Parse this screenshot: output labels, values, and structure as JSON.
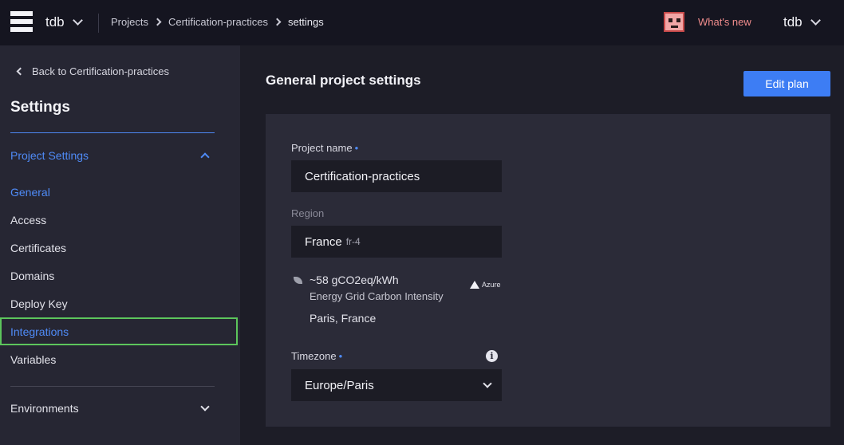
{
  "topbar": {
    "org_name": "tdb",
    "breadcrumb": [
      "Projects",
      "Certification-practices",
      "settings"
    ],
    "whats_new": "What's new",
    "user_name": "tdb"
  },
  "sidebar": {
    "back_label": "Back to Certification-practices",
    "title": "Settings",
    "section_label": "Project Settings",
    "items": [
      {
        "label": "General"
      },
      {
        "label": "Access"
      },
      {
        "label": "Certificates"
      },
      {
        "label": "Domains"
      },
      {
        "label": "Deploy Key"
      },
      {
        "label": "Integrations"
      },
      {
        "label": "Variables"
      }
    ],
    "environments_label": "Environments"
  },
  "main": {
    "title": "General project settings",
    "edit_plan_label": "Edit plan",
    "project_name_label": "Project name",
    "required_marker": "•",
    "project_name_value": "Certification-practices",
    "region_label": "Region",
    "region_name": "France",
    "region_code": "fr-4",
    "carbon_value": "~58 gCO2eq/kWh",
    "carbon_caption": "Energy Grid Carbon Intensity",
    "region_city": "Paris, France",
    "provider": "Azure",
    "timezone_label": "Timezone",
    "info_glyph": "i",
    "timezone_value": "Europe/Paris"
  },
  "colors": {
    "accent": "#4f8bf7",
    "button": "#3d7df4",
    "highlight_border": "#5cc55c",
    "whats_new": "#f08c8c"
  },
  "icons": [
    "menu-icon",
    "chevron-down-icon",
    "chevron-right-icon",
    "mascot-icon",
    "chevron-left-icon",
    "chevron-up-icon",
    "leaf-icon",
    "azure-logo-icon",
    "info-icon"
  ]
}
